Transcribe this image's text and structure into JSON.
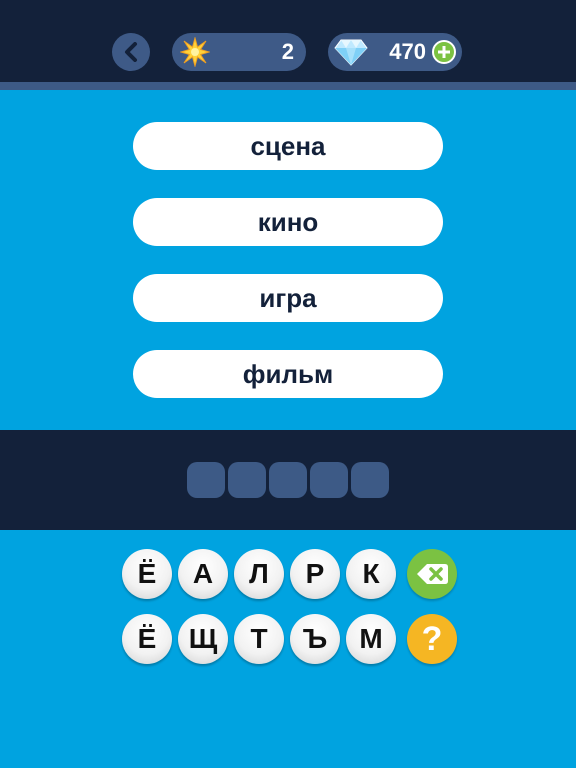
{
  "header": {
    "back_icon": "chevron-left-icon",
    "level": {
      "icon": "sparkle-icon",
      "value": "2"
    },
    "gems": {
      "icon": "diamond-icon",
      "value": "470",
      "add_icon": "plus-icon"
    }
  },
  "clues": [
    "сцена",
    "кино",
    "игра",
    "фильм"
  ],
  "answer": {
    "slot_count": 5
  },
  "keyboard": {
    "row1": [
      "Ё",
      "А",
      "Л",
      "Р",
      "К"
    ],
    "row2": [
      "Ё",
      "Щ",
      "Т",
      "Ъ",
      "М"
    ],
    "delete_icon": "backspace-icon",
    "hint_icon": "question-icon",
    "hint_glyph": "?"
  },
  "colors": {
    "background": "#00a3e0",
    "dark_band": "#13213a",
    "pill": "#3e5a87",
    "green": "#7bc242",
    "yellow": "#f5b623"
  }
}
